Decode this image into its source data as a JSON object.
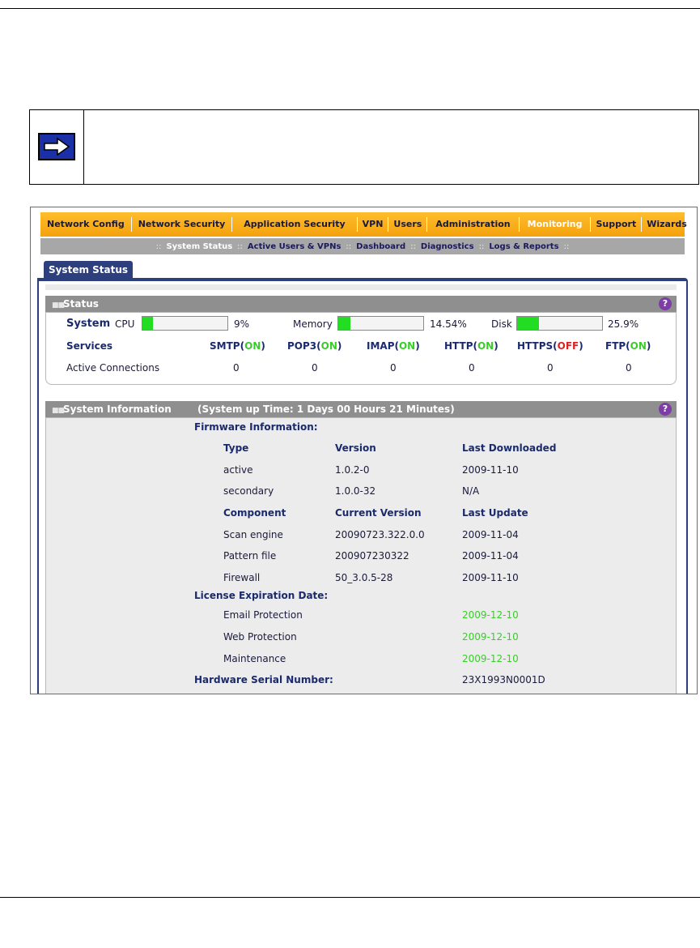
{
  "menu": {
    "items": [
      {
        "label": "Network Config",
        "active": false
      },
      {
        "label": "Network Security",
        "active": false
      },
      {
        "label": "Application Security",
        "active": false
      },
      {
        "label": "VPN",
        "active": false
      },
      {
        "label": "Users",
        "active": false
      },
      {
        "label": "Administration",
        "active": false
      },
      {
        "label": "Monitoring",
        "active": true
      },
      {
        "label": "Support",
        "active": false
      },
      {
        "label": "Wizards",
        "active": false
      }
    ]
  },
  "submenu": {
    "separator": "::",
    "items": [
      {
        "label": "System Status",
        "active": true
      },
      {
        "label": "Active Users & VPNs",
        "active": false
      },
      {
        "label": "Dashboard",
        "active": false
      },
      {
        "label": "Diagnostics",
        "active": false
      },
      {
        "label": "Logs & Reports",
        "active": false
      }
    ]
  },
  "tab": {
    "label": "System Status"
  },
  "status": {
    "header": "Status",
    "system_label": "System",
    "cpu": {
      "label": "CPU",
      "value": "9%",
      "fraction": 0.09
    },
    "memory": {
      "label": "Memory",
      "value": "14.54%",
      "fraction": 0.1454
    },
    "disk": {
      "label": "Disk",
      "value": "25.9%",
      "fraction": 0.259
    },
    "services_label": "Services",
    "services": [
      {
        "name": "SMTP(",
        "state": "ON",
        "close": ")"
      },
      {
        "name": "POP3(",
        "state": "ON",
        "close": ")"
      },
      {
        "name": "IMAP(",
        "state": "ON",
        "close": ")"
      },
      {
        "name": "HTTP(",
        "state": "ON",
        "close": ")"
      },
      {
        "name": "HTTPS(",
        "state": "OFF",
        "close": ")"
      },
      {
        "name": "FTP(",
        "state": "ON",
        "close": ")"
      }
    ],
    "active_connections_label": "Active Connections",
    "connections": [
      "0",
      "0",
      "0",
      "0",
      "0",
      "0"
    ]
  },
  "sysinfo": {
    "header": "System Information",
    "uptime": "(System up Time: 1 Days 00 Hours 21 Minutes)",
    "firmware_label": "Firmware Information:",
    "fw_headers": [
      "Type",
      "Version",
      "Last Downloaded"
    ],
    "fw_rows": [
      [
        "active",
        "1.0.2-0",
        "2009-11-10"
      ],
      [
        "secondary",
        "1.0.0-32",
        "N/A"
      ]
    ],
    "comp_headers": [
      "Component",
      "Current Version",
      "Last Update"
    ],
    "comp_rows": [
      [
        "Scan engine",
        "20090723.322.0.0",
        "2009-11-04"
      ],
      [
        "Pattern file",
        "200907230322",
        "2009-11-04"
      ],
      [
        "Firewall",
        "50_3.0.5-28",
        "2009-11-10"
      ]
    ],
    "license_label": "License Expiration Date:",
    "licenses": [
      [
        "Email Protection",
        "2009-12-10"
      ],
      [
        "Web Protection",
        "2009-12-10"
      ],
      [
        "Maintenance",
        "2009-12-10"
      ]
    ],
    "serial_label": "Hardware Serial Number:",
    "serial": "23X1993N0001D"
  },
  "colors": {
    "menu": "#f4a10d",
    "tab": "#2e3f7e",
    "on": "#3acd2a",
    "off": "#e02020",
    "bar_fill": "#22dd22"
  },
  "icons": {
    "note": "arrow-right-icon",
    "help": "help-icon"
  }
}
